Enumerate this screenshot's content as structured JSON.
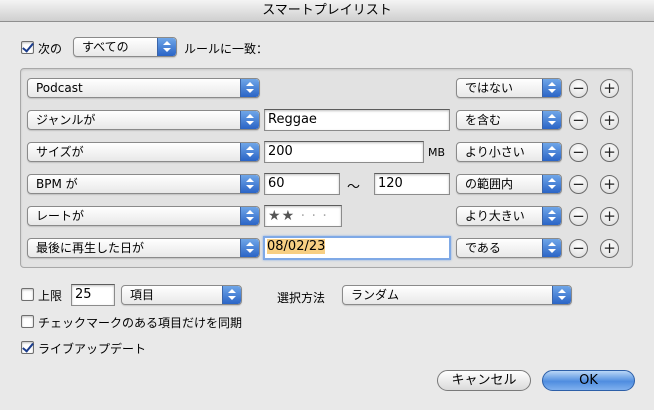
{
  "window": {
    "title": "スマートプレイリスト"
  },
  "match": {
    "checked": true,
    "prefix": "次の",
    "selector": "すべての",
    "suffix": "ルールに一致："
  },
  "rules": [
    {
      "field": "Podcast",
      "operator": "ではない"
    },
    {
      "field": "ジャンルが",
      "value": "Reggae",
      "operator": "を含む"
    },
    {
      "field": "サイズが",
      "value": "200",
      "unit": "MB",
      "operator": "より小さい"
    },
    {
      "field": "BPM が",
      "value_from": "60",
      "range_sep": "〜",
      "value_to": "120",
      "operator": "の範囲内"
    },
    {
      "field": "レートが",
      "rating": 2,
      "rating_max": 5,
      "operator": "より大きい"
    },
    {
      "field": "最後に再生した日が",
      "value": "08/02/23",
      "operator": "である"
    }
  ],
  "remove_glyph": "−",
  "add_glyph": "+",
  "limit": {
    "checked": false,
    "label": "上限",
    "value": "25",
    "unit": "項目",
    "method_label": "選択方法",
    "method": "ランダム"
  },
  "sync_checked": {
    "checked": false,
    "label": "チェックマークのある項目だけを同期"
  },
  "live_update": {
    "checked": true,
    "label": "ライブアップデート"
  },
  "buttons": {
    "cancel": "キャンセル",
    "ok": "OK"
  }
}
